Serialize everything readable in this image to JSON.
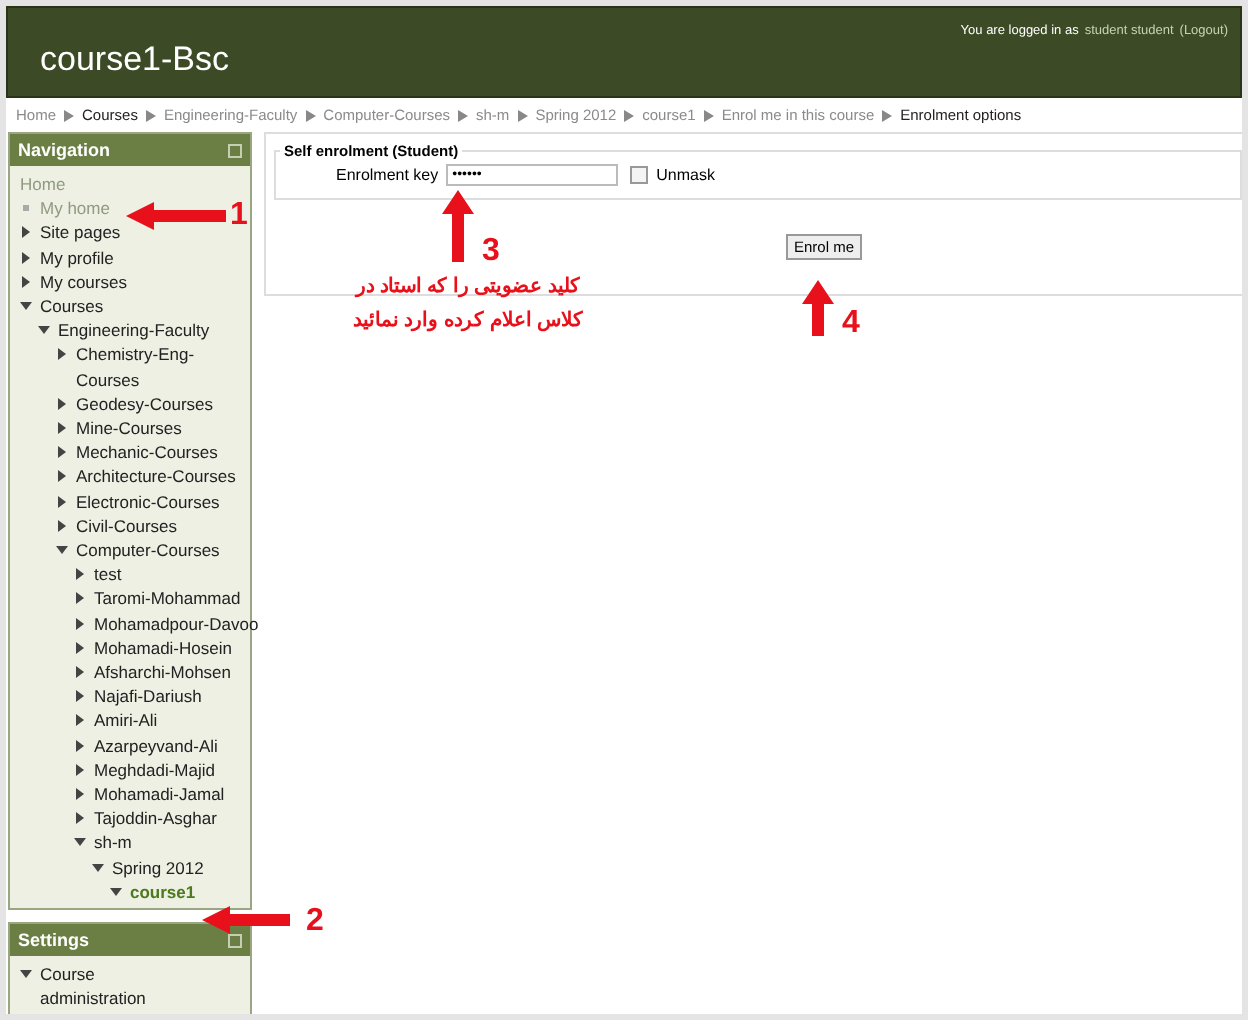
{
  "header": {
    "site_title": "course1-Bsc",
    "login_prefix": "You are logged in as",
    "login_user": "student student",
    "logout": "(Logout)"
  },
  "breadcrumb": [
    {
      "label": "Home",
      "current": false
    },
    {
      "label": "Courses",
      "current": true
    },
    {
      "label": "Engineering-Faculty",
      "current": false
    },
    {
      "label": "Computer-Courses",
      "current": false
    },
    {
      "label": "sh-m",
      "current": false
    },
    {
      "label": "Spring 2012",
      "current": false
    },
    {
      "label": "course1",
      "current": false
    },
    {
      "label": "Enrol me in this course",
      "current": false
    },
    {
      "label": "Enrolment options",
      "current": true
    }
  ],
  "navigation": {
    "title": "Navigation",
    "items": [
      {
        "label": "Home",
        "kind": "plain",
        "selected": false
      },
      {
        "label": "My home",
        "kind": "leaf",
        "selected": false
      },
      {
        "label": "Site pages",
        "kind": "branch",
        "expanded": false,
        "selected": false
      },
      {
        "label": "My profile",
        "kind": "branch",
        "expanded": false,
        "selected": false
      },
      {
        "label": "My courses",
        "kind": "branch",
        "expanded": false,
        "selected": false
      },
      {
        "label": "Courses",
        "kind": "branch",
        "expanded": true,
        "selected": false,
        "children": [
          {
            "label": "Engineering-Faculty",
            "kind": "branch",
            "expanded": true,
            "selected": false,
            "children": [
              {
                "label": "Chemistry-Eng-Courses",
                "kind": "branch",
                "expanded": false,
                "selected": false
              },
              {
                "label": "Geodesy-Courses",
                "kind": "branch",
                "expanded": false,
                "selected": false
              },
              {
                "label": "Mine-Courses",
                "kind": "branch",
                "expanded": false,
                "selected": false
              },
              {
                "label": "Mechanic-Courses",
                "kind": "branch",
                "expanded": false,
                "selected": false
              },
              {
                "label": "Architecture-Courses",
                "kind": "branch",
                "expanded": false,
                "selected": false
              },
              {
                "label": "Electronic-Courses",
                "kind": "branch",
                "expanded": false,
                "selected": false
              },
              {
                "label": "Civil-Courses",
                "kind": "branch",
                "expanded": false,
                "selected": false
              },
              {
                "label": "Computer-Courses",
                "kind": "branch",
                "expanded": true,
                "selected": false,
                "children": [
                  {
                    "label": "test",
                    "kind": "branch",
                    "expanded": false,
                    "selected": false
                  },
                  {
                    "label": "Taromi-Mohammad",
                    "kind": "branch",
                    "expanded": false,
                    "selected": false
                  },
                  {
                    "label": "Mohamadpour-Davoo",
                    "kind": "branch",
                    "expanded": false,
                    "selected": false
                  },
                  {
                    "label": "Mohamadi-Hosein",
                    "kind": "branch",
                    "expanded": false,
                    "selected": false
                  },
                  {
                    "label": "Afsharchi-Mohsen",
                    "kind": "branch",
                    "expanded": false,
                    "selected": false
                  },
                  {
                    "label": "Najafi-Dariush",
                    "kind": "branch",
                    "expanded": false,
                    "selected": false
                  },
                  {
                    "label": "Amiri-Ali",
                    "kind": "branch",
                    "expanded": false,
                    "selected": false
                  },
                  {
                    "label": "Azarpeyvand-Ali",
                    "kind": "branch",
                    "expanded": false,
                    "selected": false
                  },
                  {
                    "label": "Meghdadi-Majid",
                    "kind": "branch",
                    "expanded": false,
                    "selected": false
                  },
                  {
                    "label": "Mohamadi-Jamal",
                    "kind": "branch",
                    "expanded": false,
                    "selected": false
                  },
                  {
                    "label": "Tajoddin-Asghar",
                    "kind": "branch",
                    "expanded": false,
                    "selected": false
                  },
                  {
                    "label": "sh-m",
                    "kind": "branch",
                    "expanded": true,
                    "selected": false,
                    "children": [
                      {
                        "label": "Spring 2012",
                        "kind": "branch",
                        "expanded": true,
                        "selected": false,
                        "children": [
                          {
                            "label": "course1",
                            "kind": "branch",
                            "expanded": true,
                            "selected": true
                          }
                        ]
                      }
                    ]
                  }
                ]
              }
            ]
          }
        ]
      }
    ]
  },
  "settings": {
    "title": "Settings",
    "items": [
      {
        "label": "Course administration",
        "kind": "branch",
        "expanded": true,
        "selected": false
      }
    ]
  },
  "enrolment": {
    "legend": "Self enrolment (Student)",
    "key_label": "Enrolment key",
    "key_value": "••••••",
    "unmask_label": "Unmask",
    "unmask_checked": false,
    "button": "Enrol me"
  },
  "annotations": {
    "numbers": [
      "1",
      "2",
      "3",
      "4"
    ],
    "note": "کلید عضویتی را که استاد در کلاس اعلام کرده وارد نمائید"
  }
}
